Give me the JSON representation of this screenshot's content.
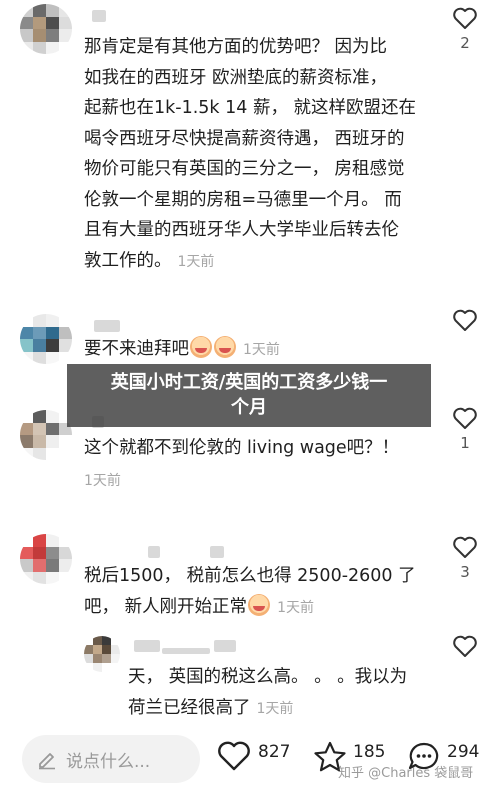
{
  "comments": [
    {
      "text_lines": [
        "那肯定是有其他方面的优势吧？ 因为比",
        "如我在的西班牙 欧洲垫底的薪资标准，",
        "起薪也在1k-1.5k 14 薪， 就这样欧盟还在",
        "喝令西班牙尽快提高薪资待遇， 西班牙的",
        "物价可能只有英国的三分之一， 房租感觉",
        "伦敦一个星期的房租=马德里一个月。 而",
        "且有大量的西班牙华人大学毕业后转去伦",
        "敦工作的。"
      ],
      "time": "1天前",
      "likes": "2"
    },
    {
      "text": "要不来迪拜吧",
      "time": "1天前",
      "likes": ""
    },
    {
      "text": "这个就都不到伦敦的 living wage吧？！",
      "time": "1天前",
      "likes": "1"
    },
    {
      "text_lines": [
        "税后1500， 税前怎么也得 2500-2600 了",
        "吧， 新人刚开始正常"
      ],
      "time": "1天前",
      "likes": "3"
    },
    {
      "text_lines": [
        "天， 英国的税这么高。 。 。我以为",
        "荷兰已经很高了"
      ],
      "time": "1天前",
      "likes": ""
    }
  ],
  "banner": {
    "line1": "英国小时工资/英国的工资多少钱一",
    "line2": "个月"
  },
  "bottom_bar": {
    "placeholder": "说点什么...",
    "likes": "827",
    "favorites": "185",
    "comments": "294"
  },
  "watermark": "知乎 @Charles 袋鼠哥",
  "icons": {
    "like": "heart-outline-icon",
    "favorite": "star-outline-icon",
    "comment": "speech-bubble-icon",
    "edit": "pencil-icon"
  }
}
